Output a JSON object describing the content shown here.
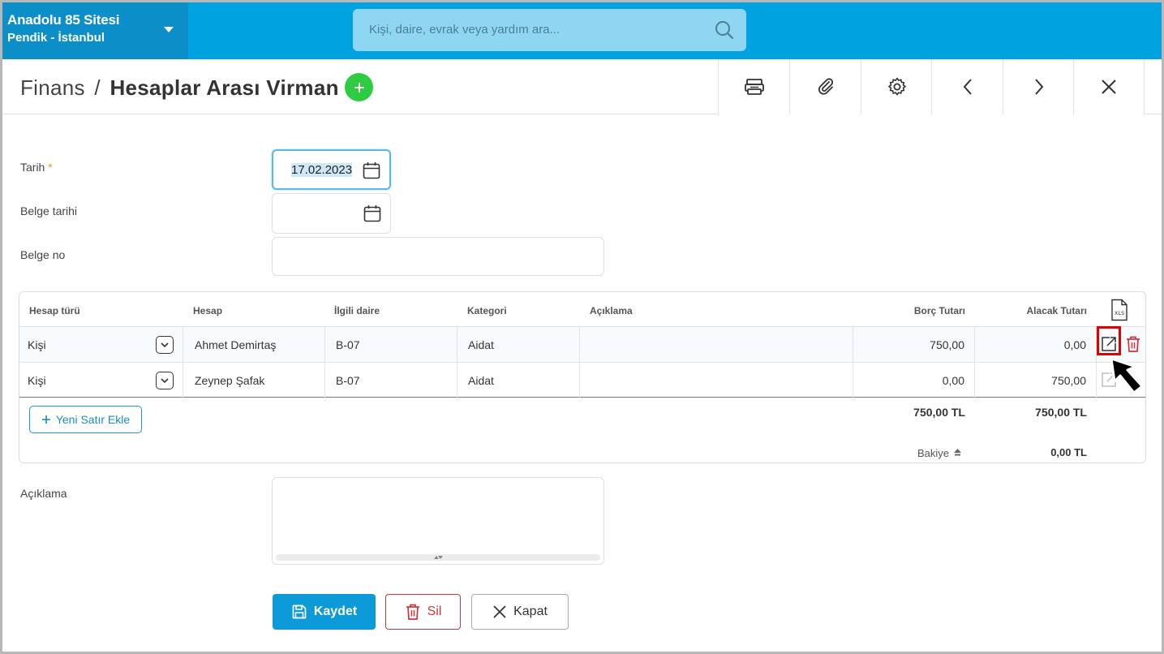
{
  "topbar": {
    "site_name": "Anadolu 85 Sitesi",
    "site_location": "Pendik - İstanbul",
    "search_placeholder": "Kişi, daire, evrak veya yardım ara...",
    "brand_color": "#00a2e0"
  },
  "header": {
    "crumb_parent": "Finans",
    "crumb_sep": "/",
    "crumb_current": "Hesaplar Arası Virman",
    "toolbar_icons": [
      "print-icon",
      "attach-icon",
      "settings-icon",
      "prev-icon",
      "next-icon",
      "close-icon"
    ]
  },
  "form": {
    "date_label": "Tarih",
    "date_required": "*",
    "date_value": "17.02.2023",
    "doc_date_label": "Belge tarihi",
    "doc_date_value": "",
    "doc_no_label": "Belge no",
    "doc_no_value": "",
    "desc_label": "Açıklama",
    "desc_value": ""
  },
  "table": {
    "columns": [
      "Hesap türü",
      "Hesap",
      "İlgili daire",
      "Kategori",
      "Açıklama",
      "Borç Tutarı",
      "Alacak Tutarı"
    ],
    "export_icon": "xls-icon",
    "rows": [
      {
        "type": "Kişi",
        "account": "Ahmet Demirtaş",
        "unit": "B-07",
        "category": "Aidat",
        "desc": "",
        "debit": "750,00",
        "credit": "0,00"
      },
      {
        "type": "Kişi",
        "account": "Zeynep Şafak",
        "unit": "B-07",
        "category": "Aidat",
        "desc": "",
        "debit": "0,00",
        "credit": "750,00"
      }
    ],
    "add_row_label": "Yeni Satır Ekle",
    "total_debit": "750,00 TL",
    "total_credit": "750,00 TL",
    "balance_label": "Bakiye",
    "balance_value": "0,00 TL"
  },
  "buttons": {
    "save": "Kaydet",
    "delete": "Sil",
    "close": "Kapat"
  }
}
